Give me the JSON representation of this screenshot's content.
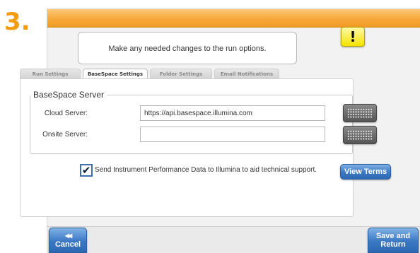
{
  "step_number": "3.",
  "alert_symbol": "!",
  "message": "Make any needed changes to the run options.",
  "tabs": [
    {
      "label": "Run Settings",
      "active": false
    },
    {
      "label": "BaseSpace Settings",
      "active": true
    },
    {
      "label": "Folder Settings",
      "active": false
    },
    {
      "label": "Email Notifications",
      "active": false
    }
  ],
  "basespace": {
    "legend": "BaseSpace Server",
    "cloud_label": "Cloud Server:",
    "cloud_value": "https://api.basespace.illumina.com",
    "onsite_label": "Onsite Server:",
    "onsite_value": ""
  },
  "performance_data": {
    "checked": true,
    "check_glyph": "✔",
    "label": "Send Instrument Performance Data to Illumina to aid technical support."
  },
  "buttons": {
    "view_terms": "View Terms",
    "cancel_glyph": "◀◀",
    "cancel": "Cancel",
    "save_line1": "Save and",
    "save_line2": "Return"
  },
  "colors": {
    "header_orange": "#f6a93a",
    "step_orange": "#f39c12",
    "button_blue": "#3b78c4",
    "alert_yellow": "#f4e400"
  },
  "icons": {
    "alert": "exclamation-icon",
    "keyboard": "keyboard-icon",
    "cancel": "rewind-icon"
  }
}
